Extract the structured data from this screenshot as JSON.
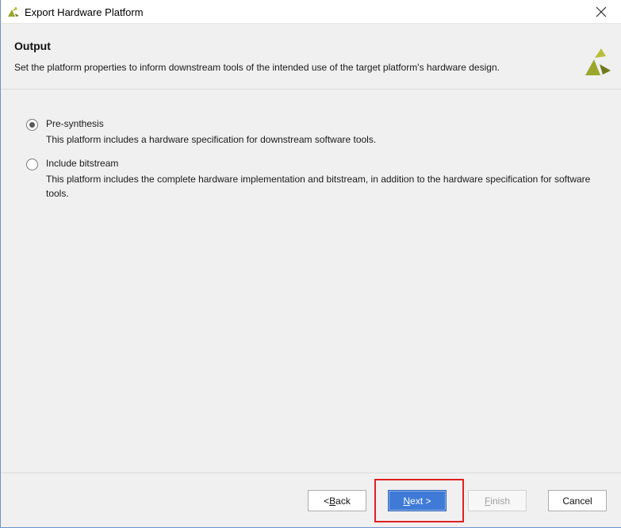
{
  "window": {
    "title": "Export Hardware Platform",
    "icon": "vivado-logo-icon",
    "close_icon": "close-icon"
  },
  "header": {
    "title": "Output",
    "description": "Set the platform properties to inform downstream tools of the intended use of the target platform's hardware design.",
    "logo": "vivado-logo-icon"
  },
  "options": [
    {
      "label": "Pre-synthesis",
      "description": "This platform includes a hardware specification for downstream software tools.",
      "checked": true
    },
    {
      "label": "Include bitstream",
      "description": "This platform includes the complete hardware implementation and bitstream, in addition to the hardware specification for software tools.",
      "checked": false
    }
  ],
  "buttons": {
    "back": {
      "prefix": "< ",
      "mnemonic": "B",
      "rest": "ack"
    },
    "next": {
      "mnemonic": "N",
      "rest": "ext >"
    },
    "finish": {
      "mnemonic": "F",
      "rest": "inish",
      "enabled": false
    },
    "cancel": {
      "label": "Cancel"
    }
  },
  "colors": {
    "accent": "#3f7bd6",
    "highlight": "#e02020",
    "logo_green": "#9aa72a",
    "logo_dark": "#6f7a1c"
  }
}
